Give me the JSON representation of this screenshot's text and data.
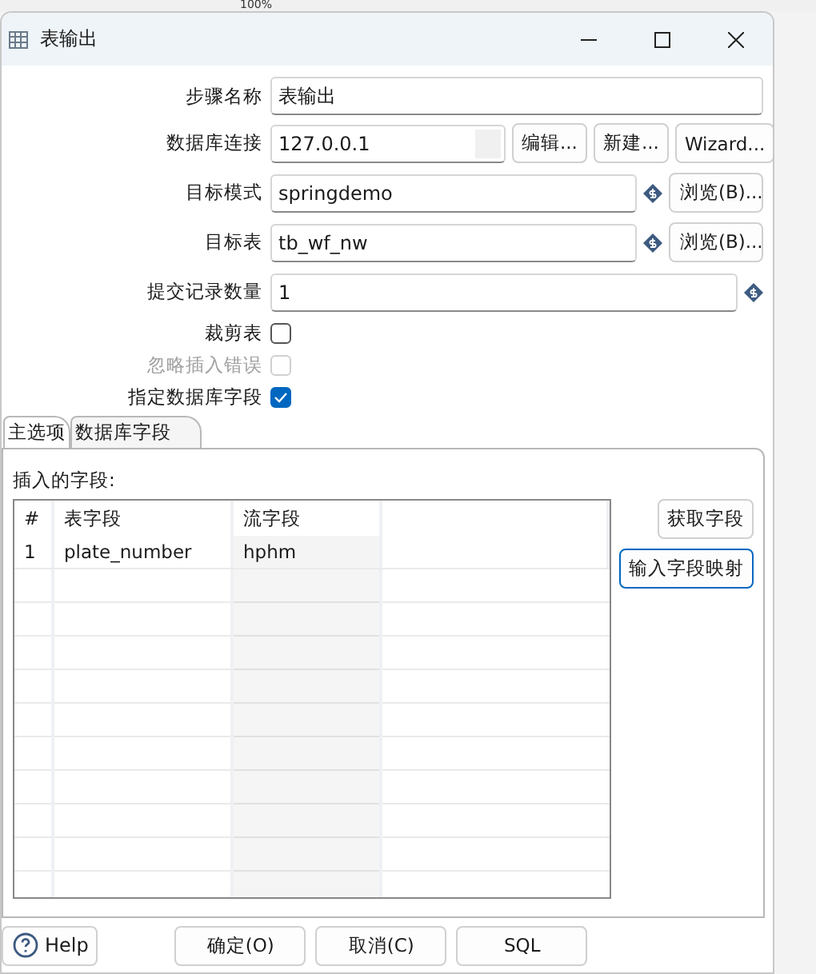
{
  "background_toolbar": {
    "zoom": "100%"
  },
  "window": {
    "title": "表输出"
  },
  "form": [
    {
      "kind": "text",
      "label": "步骤名称",
      "value": "表输出"
    },
    {
      "kind": "connection",
      "label": "数据库连接",
      "value": "127.0.0.1",
      "buttons": [
        "编辑...",
        "新建...",
        "Wizard..."
      ]
    },
    {
      "kind": "variable",
      "label": "目标模式",
      "value": "springdemo",
      "button": "浏览(B)..."
    },
    {
      "kind": "variable",
      "label": "目标表",
      "value": "tb_wf_nw",
      "button": "浏览(B)..."
    },
    {
      "kind": "variable",
      "label": "提交记录数量",
      "value": "1"
    },
    {
      "kind": "checkbox",
      "label": "裁剪表",
      "checked": false,
      "disabled": false
    },
    {
      "kind": "checkbox",
      "label": "忽略插入错误",
      "checked": false,
      "disabled": true
    },
    {
      "kind": "checkbox",
      "label": "指定数据库字段",
      "checked": true,
      "disabled": false
    }
  ],
  "tabs": [
    {
      "label": "主选项",
      "selected": false
    },
    {
      "label": "数据库字段",
      "selected": true
    }
  ],
  "fields_panel": {
    "title": "插入的字段:",
    "columns": [
      "#",
      "表字段",
      "流字段"
    ],
    "rows": [
      [
        "1",
        "plate_number",
        "hphm"
      ]
    ],
    "buttons": [
      {
        "label": "获取字段",
        "focused": false
      },
      {
        "label": "输入字段映射",
        "focused": true
      }
    ]
  },
  "footer": {
    "help": "Help",
    "buttons": [
      "确定(O)",
      "取消(C)",
      "SQL"
    ]
  }
}
